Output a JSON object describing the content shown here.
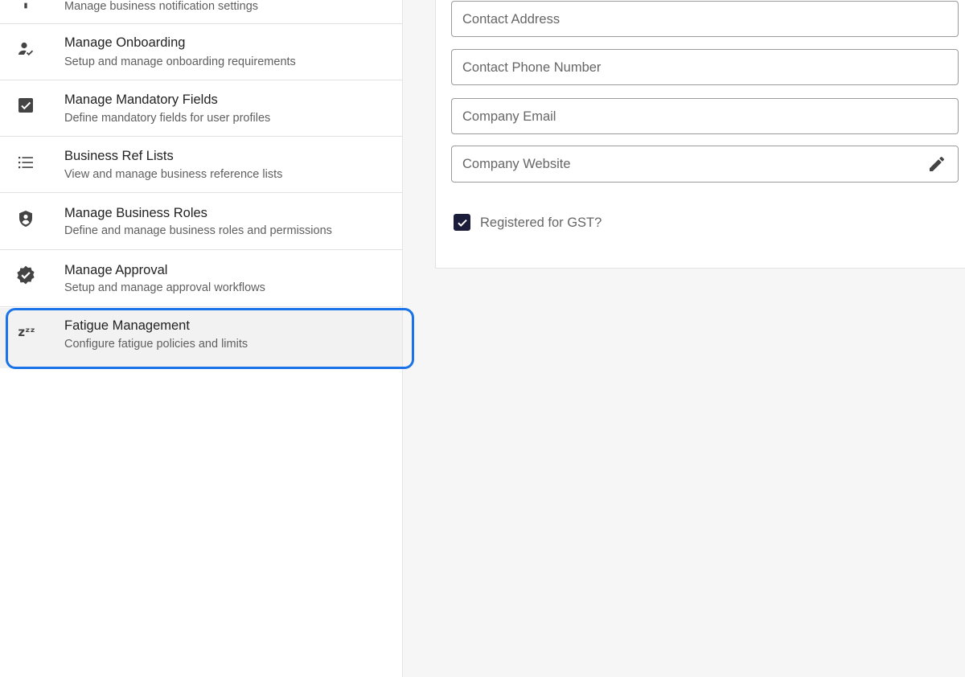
{
  "sidebar": {
    "items": [
      {
        "id": "notifications",
        "icon": "notification-icon",
        "title": "",
        "subtitle": "Manage business notification settings"
      },
      {
        "id": "onboarding",
        "icon": "person-check-icon",
        "title": "Manage Onboarding",
        "subtitle": "Setup and manage onboarding requirements"
      },
      {
        "id": "mandatory-fields",
        "icon": "checkbox-icon",
        "title": "Manage Mandatory Fields",
        "subtitle": "Define mandatory fields for user profiles"
      },
      {
        "id": "ref-lists",
        "icon": "list-icon",
        "title": "Business Ref Lists",
        "subtitle": "View and manage business reference lists"
      },
      {
        "id": "roles",
        "icon": "shield-person-icon",
        "title": "Manage Business Roles",
        "subtitle": "Define and manage business roles and permissions"
      },
      {
        "id": "approval",
        "icon": "verified-badge-icon",
        "title": "Manage Approval",
        "subtitle": "Setup and manage approval workflows"
      },
      {
        "id": "fatigue",
        "icon": "sleep-zzz-icon",
        "title": "Fatigue Management",
        "subtitle": "Configure fatigue policies and limits",
        "selected": true
      }
    ]
  },
  "form": {
    "contact_address_placeholder": "Contact Address",
    "contact_phone_placeholder": "Contact Phone Number",
    "company_email_placeholder": "Company Email",
    "company_website_placeholder": "Company Website",
    "gst_label": "Registered for GST?",
    "gst_checked": true
  },
  "colors": {
    "focus": "#1a73e8",
    "checkbox": "#1b1b3a"
  },
  "zzz_glyph": "zᶻᶻ"
}
